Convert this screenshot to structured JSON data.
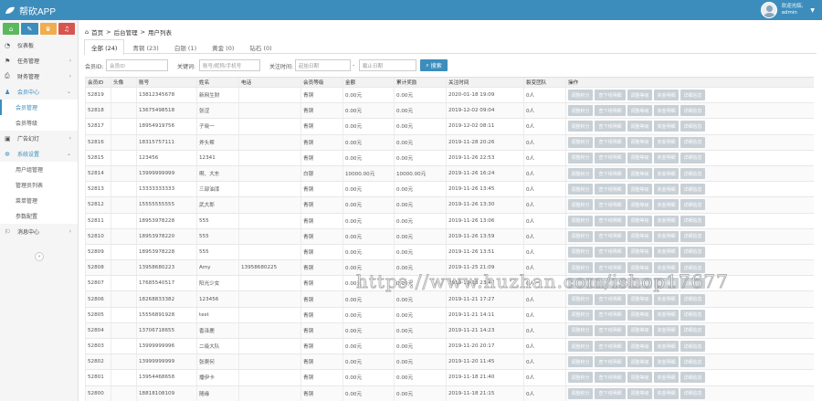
{
  "header": {
    "app_title": "帮砍APP",
    "user_line1": "欢迎光临,",
    "user_line2": "admin",
    "caret": "▼"
  },
  "sidebar": {
    "quick_buttons": [
      {
        "icon": "home-icon",
        "glyph": "⌂",
        "color": "#5cb85c"
      },
      {
        "icon": "pencil-icon",
        "glyph": "✎",
        "color": "#3c8dbc"
      },
      {
        "icon": "shield-icon",
        "glyph": "♛",
        "color": "#f0ad4e"
      },
      {
        "icon": "bell-icon",
        "glyph": "♫",
        "color": "#d9534f"
      }
    ],
    "items": [
      {
        "label": "仪表板",
        "icon": "dashboard-icon",
        "glyph": "◔",
        "arrow": ""
      },
      {
        "label": "任务管理",
        "icon": "flag-icon",
        "glyph": "⚑",
        "arrow": "›"
      },
      {
        "label": "财务管理",
        "icon": "print-icon",
        "glyph": "⎙",
        "arrow": "›"
      },
      {
        "label": "会员中心",
        "icon": "user-icon",
        "glyph": "♟",
        "arrow": "⌄"
      },
      {
        "label": "会员管理",
        "sub": true,
        "active": true
      },
      {
        "label": "会员等级",
        "sub": true
      },
      {
        "label": "广告幻灯",
        "icon": "image-icon",
        "glyph": "▣",
        "arrow": "›"
      },
      {
        "label": "系统设置",
        "icon": "gear-icon",
        "glyph": "✲",
        "arrow": "⌄"
      },
      {
        "label": "用户组管理",
        "sub": true
      },
      {
        "label": "管理员列表",
        "sub": true
      },
      {
        "label": "菜单管理",
        "sub": true
      },
      {
        "label": "参数配置",
        "sub": true
      },
      {
        "label": "消息中心",
        "icon": "bookmark-icon",
        "glyph": "⚐",
        "arrow": "›"
      }
    ],
    "collapse_glyph": "«"
  },
  "breadcrumb": {
    "home": "首页",
    "sep1": ">",
    "section": "后台管理",
    "sep2": ">",
    "page": "用户列表"
  },
  "tabs": [
    {
      "label": "全部 (24)",
      "active": true
    },
    {
      "label": "青铜 (23)"
    },
    {
      "label": "白银 (1)"
    },
    {
      "label": "黄金 (0)"
    },
    {
      "label": "钻石 (0)"
    }
  ],
  "filters": {
    "member_id_label": "会员ID:",
    "member_id_placeholder": "会员ID",
    "keyword_label": "关键词:",
    "keyword_placeholder": "账号/昵称/手机号",
    "follow_time_label": "关注时间:",
    "start_placeholder": "起始日期",
    "range_sep": "-",
    "end_placeholder": "截止日期",
    "search_label": "搜索"
  },
  "table": {
    "columns": [
      "会员ID",
      "头像",
      "账号",
      "姓名",
      "电话",
      "会员等级",
      "金额",
      "累计奖励",
      "关注时间",
      "裂变团队",
      "操作"
    ],
    "action_buttons": [
      "调整积分",
      "查下线明细",
      "调整等级",
      "资金明细",
      "详细信息"
    ],
    "rows": [
      [
        "52819",
        "",
        "13812345678",
        "新网生财",
        "",
        "青铜",
        "0.00元",
        "0.00元",
        "2020-01-18 19:09",
        "0人"
      ],
      [
        "52818",
        "",
        "13675498518",
        "张涩",
        "",
        "青铜",
        "0.00元",
        "0.00元",
        "2019-12-02 09:04",
        "0人"
      ],
      [
        "52817",
        "",
        "18954919756",
        "子晓一",
        "",
        "青铜",
        "0.00元",
        "0.00元",
        "2019-12-02 08:11",
        "0人"
      ],
      [
        "52816",
        "",
        "18315757111",
        "斧头帮",
        "",
        "青铜",
        "0.00元",
        "0.00元",
        "2019-11-28 20:26",
        "0人"
      ],
      [
        "52815",
        "",
        "123456",
        "12341",
        "",
        "青铜",
        "0.00元",
        "0.00元",
        "2019-11-26 22:53",
        "0人"
      ],
      [
        "52814",
        "",
        "13999999999",
        "啊、大东",
        "",
        "白银",
        "10000.00元",
        "10000.00元",
        "2019-11-26 16:24",
        "0人"
      ],
      [
        "52813",
        "",
        "13333333333",
        "三部油漆",
        "",
        "青铜",
        "0.00元",
        "0.00元",
        "2019-11-26 13:45",
        "0人"
      ],
      [
        "52812",
        "",
        "15555555555",
        "武大郎",
        "",
        "青铜",
        "0.00元",
        "0.00元",
        "2019-11-26 13:30",
        "0人"
      ],
      [
        "52811",
        "",
        "18953978228",
        "555",
        "",
        "青铜",
        "0.00元",
        "0.00元",
        "2019-11-26 13:06",
        "0人"
      ],
      [
        "52810",
        "",
        "18953978220",
        "555",
        "",
        "青铜",
        "0.00元",
        "0.00元",
        "2019-11-26 13:59",
        "0人"
      ],
      [
        "52809",
        "",
        "18953978228",
        "555",
        "",
        "青铜",
        "0.00元",
        "0.00元",
        "2019-11-26 13:51",
        "0人"
      ],
      [
        "52808",
        "",
        "13958680223",
        "Amy",
        "13958680225",
        "青铜",
        "0.00元",
        "0.00元",
        "2019-11-25 21:09",
        "0人"
      ],
      [
        "52807",
        "",
        "17685540517",
        "阳光少女",
        "",
        "青铜",
        "0.00元",
        "0.00元",
        "2019-11-23 23:47",
        "0人"
      ],
      [
        "52806",
        "",
        "18268833382",
        "123456",
        "",
        "青铜",
        "0.00元",
        "0.00元",
        "2019-11-21 17:27",
        "0人"
      ],
      [
        "52805",
        "",
        "15556891928",
        "test",
        "",
        "青铜",
        "0.00元",
        "0.00元",
        "2019-11-21 14:11",
        "0人"
      ],
      [
        "52804",
        "",
        "13706718655",
        "香泽鹿",
        "",
        "青铜",
        "0.00元",
        "0.00元",
        "2019-11-21 14:23",
        "0人"
      ],
      [
        "52803",
        "",
        "13999999996",
        "二级大队",
        "",
        "青铜",
        "0.00元",
        "0.00元",
        "2019-11-20 20:17",
        "0人"
      ],
      [
        "52802",
        "",
        "13999999999",
        "张爬何",
        "",
        "青铜",
        "0.00元",
        "0.00元",
        "2019-11-20 11:45",
        "0人"
      ],
      [
        "52801",
        "",
        "13954468658",
        "播伊卡",
        "",
        "青铜",
        "0.00元",
        "0.00元",
        "2019-11-18 21:40",
        "0人"
      ],
      [
        "52800",
        "",
        "18818108109",
        "随缘",
        "",
        "青铜",
        "0.00元",
        "0.00元",
        "2019-11-18 21:15",
        "0人"
      ]
    ]
  },
  "watermark": "https://www.huzhan.com/ishop17677"
}
